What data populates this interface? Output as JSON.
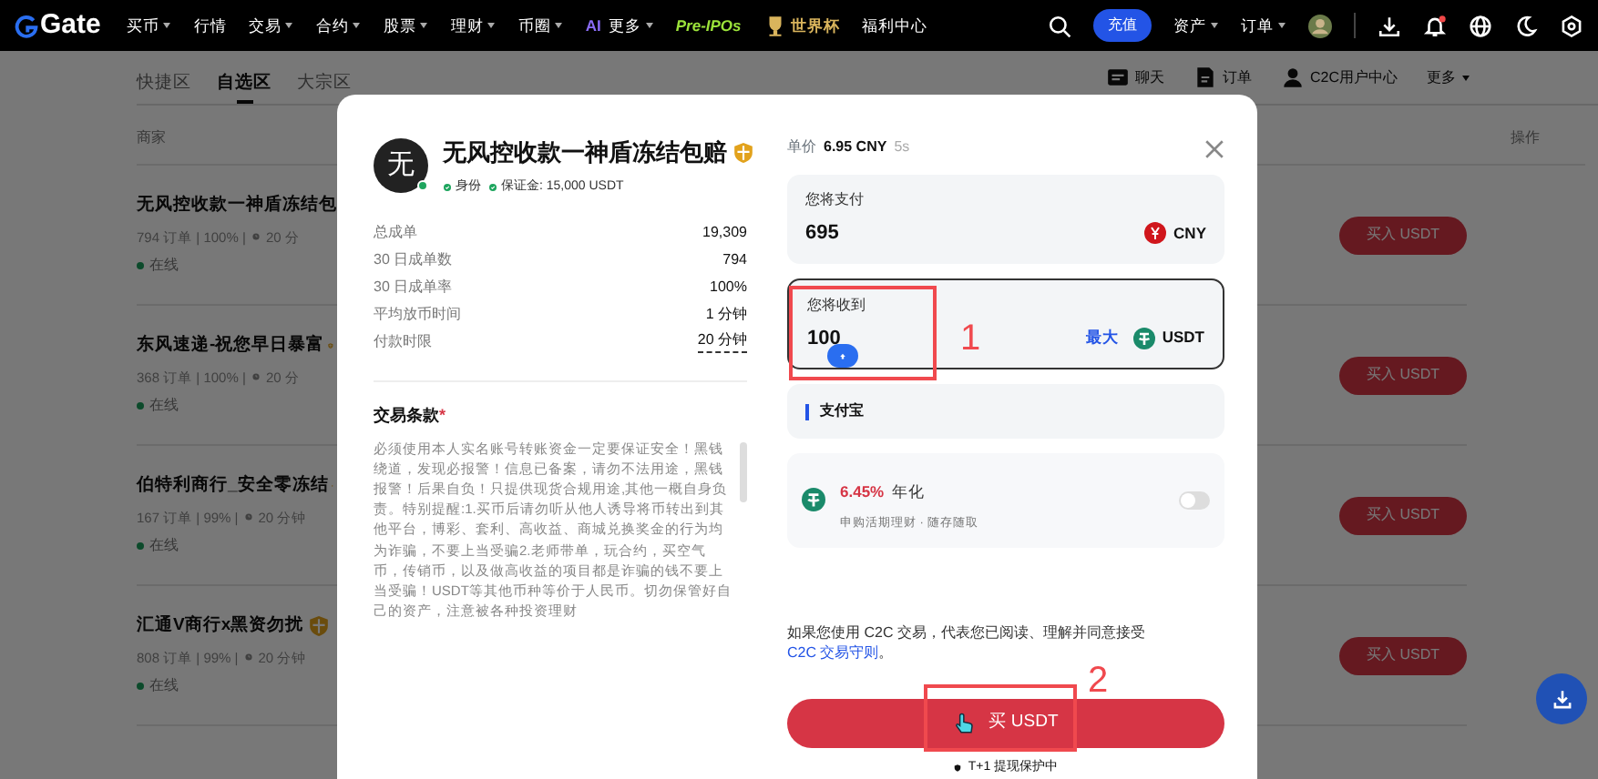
{
  "nav": {
    "logo": "Gate",
    "items": [
      {
        "label": "买币",
        "dropdown": true
      },
      {
        "label": "行情",
        "dropdown": false
      },
      {
        "label": "交易",
        "dropdown": true
      },
      {
        "label": "合约",
        "dropdown": true
      },
      {
        "label": "股票",
        "dropdown": true
      },
      {
        "label": "理财",
        "dropdown": true
      },
      {
        "label": "币圈",
        "dropdown": true
      },
      {
        "label": "更多",
        "prefix": "AI",
        "dropdown": true
      },
      {
        "label": "Pre-IPOs",
        "kind": "green",
        "dropdown": false
      },
      {
        "label": "世界杯",
        "kind": "gold",
        "dropdown": false
      },
      {
        "label": "福利中心",
        "dropdown": false
      }
    ],
    "deposit": "充值",
    "menus": [
      "资产",
      "订单"
    ],
    "notification_dot": true
  },
  "subtabs": [
    {
      "label": "快捷区",
      "selected": false
    },
    {
      "label": "自选区",
      "selected": true
    },
    {
      "label": "大宗区",
      "selected": false
    }
  ],
  "toolbar": [
    {
      "kind": "chat",
      "label": "聊天"
    },
    {
      "kind": "orders",
      "label": "订单"
    },
    {
      "kind": "user",
      "label": "C2C用户中心"
    },
    {
      "kind": "more",
      "label": "更多"
    }
  ],
  "list": {
    "column_1": "商家",
    "column_2": "操作",
    "rows": [
      {
        "name": "无风控收款一神盾冻结包",
        "verified": false,
        "summary": "794 订单 | 100% |",
        "time": "20 分",
        "status": "在线",
        "action": "买入 USDT"
      },
      {
        "name": "东风速递-祝您早日暴富",
        "verified": true,
        "summary": "368 订单 | 100% |",
        "time": "20 分",
        "status": "在线",
        "action": "买入 USDT"
      },
      {
        "name": "伯特利商行_安全零冻结",
        "verified": true,
        "summary": "167 订单 | 99% |",
        "time": "20 分钟",
        "status": "在线",
        "action": "买入 USDT"
      },
      {
        "name": "汇通V商行x黑资勿扰",
        "verified": true,
        "summary": "808 订单 | 99% |",
        "time": "20 分钟",
        "status": "在线",
        "action": "买入 USDT"
      }
    ]
  },
  "modal": {
    "avatar": "无",
    "merchant": "无风控收款一神盾冻结包赔",
    "verified": true,
    "online": true,
    "badges": [
      "身份",
      "保证金: 15,000 USDT"
    ],
    "stats": [
      {
        "label": "总成单",
        "value": "19,309"
      },
      {
        "label": "30 日成单数",
        "value": "794"
      },
      {
        "label": "30 日成单率",
        "value": "100%"
      },
      {
        "label": "平均放币时间",
        "value": "1 分钟"
      },
      {
        "label": "付款时限",
        "value": "20 分钟"
      }
    ],
    "terms_title": "交易条款",
    "terms_required": "*",
    "terms": "必须使用本人实名账号转账资金一定要保证安全！黑钱绕道，发现必报警！信息已备案，请勿不法用途，黑钱报警！后果自负！只提供现货合规用途,其他一概自身负责。特别提醒:1.买币后请勿听从他人诱导将币转出到其他平台，博彩、套利、高收益、商城兑换奖金的行为均为诈骗，不要上当受骗2.老师带单，玩合约，买空气币，传销币，以及做高收益的项目都是诈骗的钱不要上当受骗！USDT等其他币种等价于人民币。切勿保管好自己的资产，注意被各种投资理财",
    "price_label": "单价",
    "price": "6.95 CNY",
    "countdown": "5s",
    "pay": {
      "label": "您将支付",
      "value": "695",
      "currency": "CNY"
    },
    "receive": {
      "label": "您将收到",
      "value": "100",
      "max": "最大",
      "currency": "USDT"
    },
    "payment_method": "支付宝",
    "earn": {
      "rate": "6.45%",
      "rate_label": "年化",
      "note": "申购活期理财 · 随存随取",
      "on": false
    },
    "agreement": {
      "text": "如果您使用 C2C 交易，代表您已阅读、理解并同意接受 ",
      "link": "C2C 交易守则",
      "end": "。"
    },
    "buy_button": "买 USDT",
    "footer": "T+1 提现保护中"
  },
  "annotations": [
    {
      "label": "1"
    },
    {
      "label": "2"
    }
  ]
}
